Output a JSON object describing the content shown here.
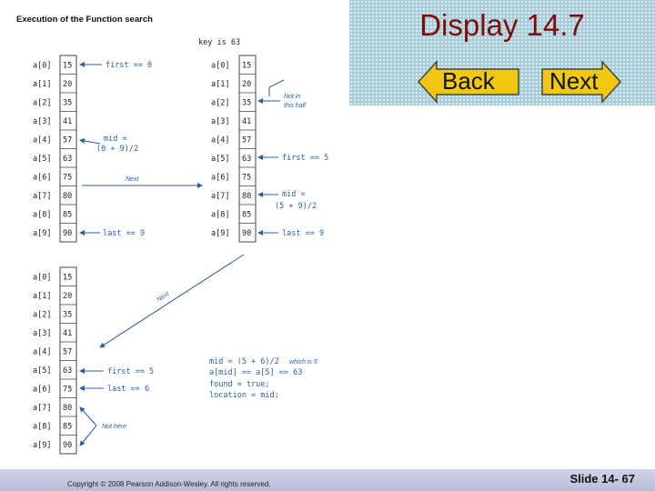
{
  "slide": {
    "title": "Display 14.7",
    "back_label": "Back",
    "next_label": "Next",
    "copyright": "Copyright © 2008 Pearson Addison-Wesley.  All rights reserved.",
    "slide_number": "Slide 14- 67",
    "panel_color": "#a9cdd8",
    "title_color": "#7a0e0e"
  },
  "figure": {
    "title": "Execution of the Function search",
    "key_label": "key is 63",
    "index_labels": [
      "a[0]",
      "a[1]",
      "a[2]",
      "a[3]",
      "a[4]",
      "a[5]",
      "a[6]",
      "a[7]",
      "a[8]",
      "a[9]"
    ],
    "values": [
      "15",
      "20",
      "35",
      "41",
      "57",
      "63",
      "75",
      "80",
      "85",
      "90"
    ],
    "top_left": {
      "first": "first == 0",
      "mid_line1": "mid =",
      "mid_line2": "(0 + 9)/2",
      "next": "Next",
      "last": "last == 9"
    },
    "top_right": {
      "not_in_1": "Not in",
      "not_in_2": "this half",
      "first": "first == 5",
      "mid_line1": "mid =",
      "mid_line2": "(5 + 9)/2",
      "last": "last == 9"
    },
    "diagonal_next": "Next",
    "bottom": {
      "first": "first == 5",
      "last": "last == 6",
      "code1": "mid = (5 + 6)/2",
      "code1_note": "which is 5",
      "code2": "a[mid] == a[5] == 63",
      "code3": "found = true;",
      "code4": "location = mid;",
      "not_here": "Not here"
    }
  }
}
